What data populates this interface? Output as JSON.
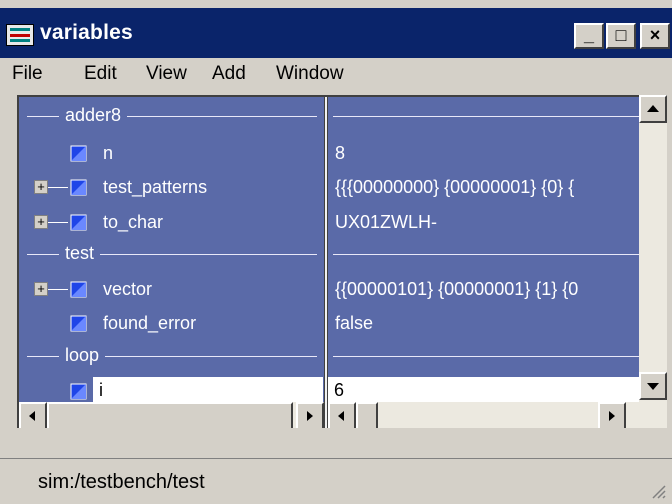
{
  "window": {
    "title": "variables",
    "controls": {
      "minimize": "_",
      "maximize": "□",
      "close": "×"
    }
  },
  "menu": [
    "File",
    "Edit",
    "View",
    "Add",
    "Window"
  ],
  "groups": [
    {
      "label": "adder8"
    },
    {
      "label": "test"
    },
    {
      "label": "loop"
    }
  ],
  "variables": [
    {
      "name": "n",
      "value": "8",
      "expandable": false,
      "selected": false
    },
    {
      "name": "test_patterns",
      "value": "{{{00000000} {00000001} {0} {",
      "expandable": true,
      "selected": false
    },
    {
      "name": "to_char",
      "value": "UX01ZWLH-",
      "expandable": true,
      "selected": false
    },
    {
      "name": "vector",
      "value": "{{00000101} {00000001} {1} {0",
      "expandable": true,
      "selected": false
    },
    {
      "name": "found_error",
      "value": "false",
      "expandable": false,
      "selected": false
    },
    {
      "name": "i",
      "value": "6",
      "expandable": false,
      "selected": true
    }
  ],
  "status": {
    "path": "sim:/testbench/test"
  },
  "colors": {
    "panel_bg": "#5a6aa8",
    "title_bg": "#0a246a",
    "icon_blue": "#1f45e8"
  }
}
